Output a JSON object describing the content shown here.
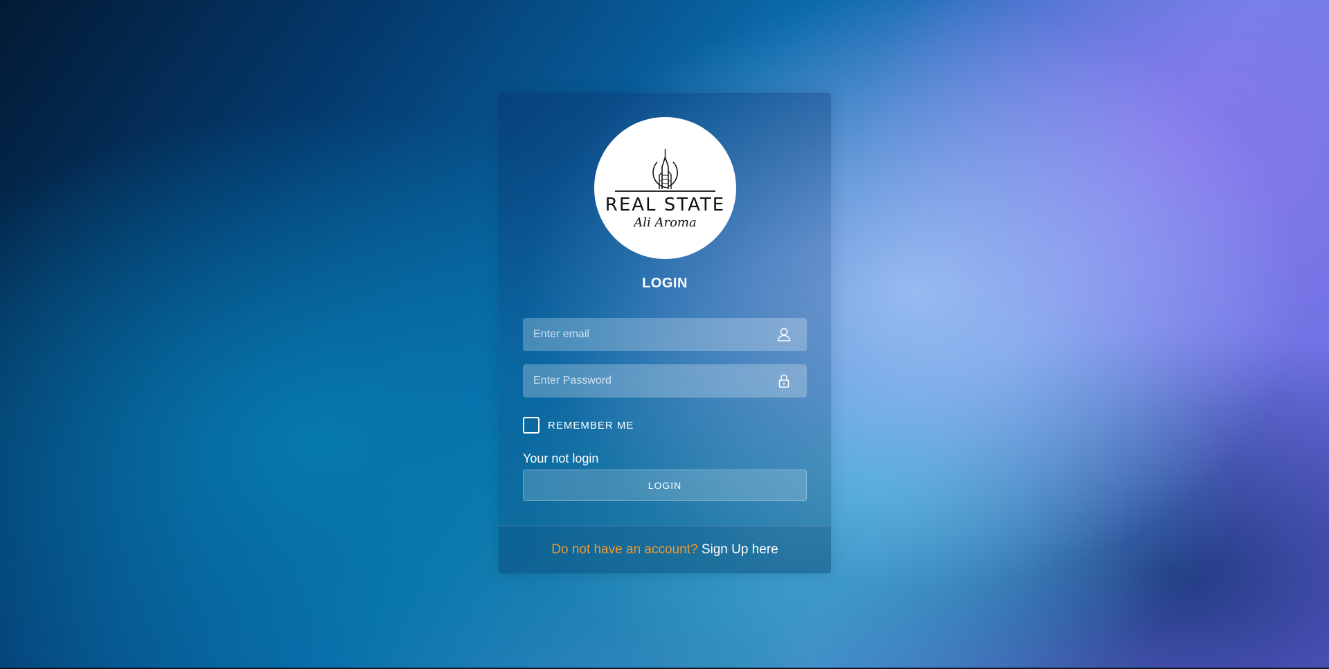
{
  "logo": {
    "title": "REAL STATE",
    "subtitle": "Ali Aroma"
  },
  "login": {
    "heading": "LOGIN",
    "email_placeholder": "Enter email",
    "password_placeholder": "Enter Password",
    "remember_label": "REMEMBER ME",
    "status_text": "Your not login",
    "button_label": "LOGIN"
  },
  "footer": {
    "question": "Do not have an account?",
    "signup_link": "Sign Up here"
  },
  "icons": {
    "email": "user-icon",
    "password": "lock-icon"
  },
  "colors": {
    "footer_question": "#ef9a2e",
    "text": "#ffffff"
  }
}
